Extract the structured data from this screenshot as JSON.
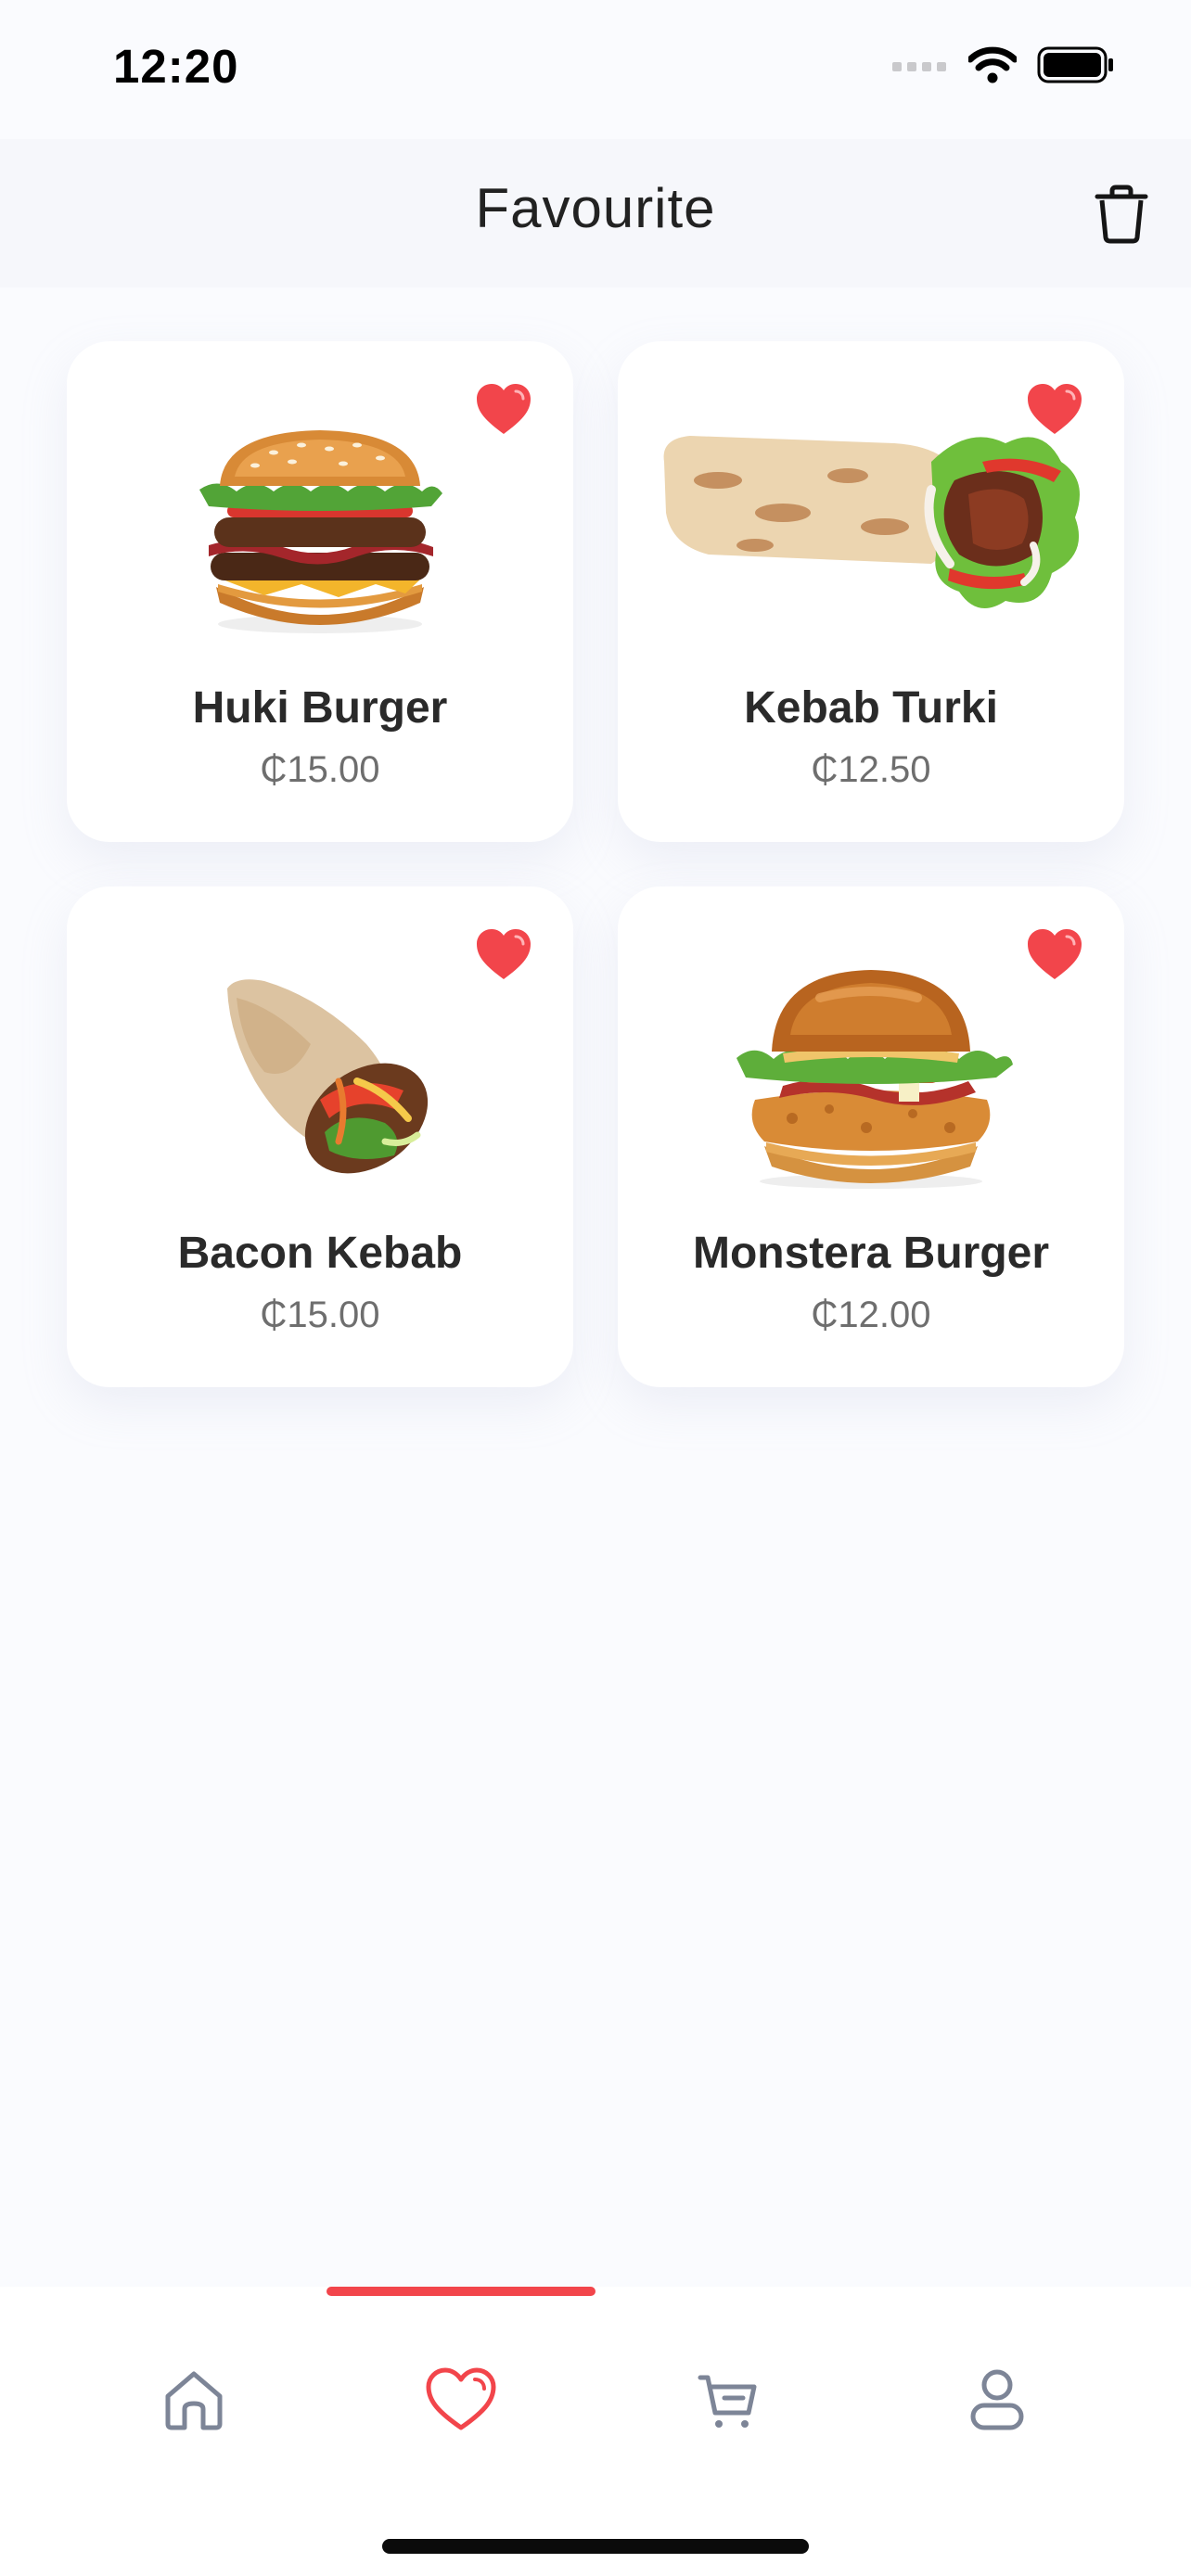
{
  "status_bar": {
    "time": "12:20"
  },
  "header": {
    "title": "Favourite",
    "trash_icon": "trash-icon"
  },
  "colors": {
    "accent": "#f2454b",
    "inactive_icon": "#7d8597"
  },
  "items": [
    {
      "name": "Huki Burger",
      "price": "₵15.00",
      "icon": "burger-image",
      "favorited": true
    },
    {
      "name": "Kebab Turki",
      "price": "₵12.50",
      "icon": "kebab-wrap-image",
      "favorited": true
    },
    {
      "name": "Bacon Kebab",
      "price": "₵15.00",
      "icon": "kebab-roll-image",
      "favorited": true
    },
    {
      "name": "Monstera Burger",
      "price": "₵12.00",
      "icon": "chicken-burger-image",
      "favorited": true
    }
  ],
  "tabbar": {
    "tabs": [
      {
        "id": "home",
        "icon": "home-icon",
        "active": false
      },
      {
        "id": "favourite",
        "icon": "heart-icon",
        "active": true
      },
      {
        "id": "cart",
        "icon": "cart-icon",
        "active": false
      },
      {
        "id": "profile",
        "icon": "profile-icon",
        "active": false
      }
    ]
  }
}
